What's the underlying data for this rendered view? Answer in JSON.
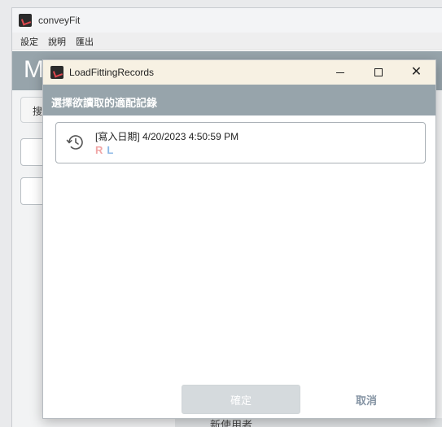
{
  "main_window": {
    "title": "conveyFit",
    "icon": "app-logo-icon",
    "menu": [
      "設定",
      "說明",
      "匯出"
    ],
    "header_letter": "M",
    "search_label": "搜",
    "bottom_text": "新使用者"
  },
  "dialog": {
    "title": "LoadFittingRecords",
    "icon": "app-logo-icon",
    "window_buttons": [
      "minimize-icon",
      "maximize-icon",
      "close-icon"
    ],
    "heading": "選擇欲讀取的適配記錄",
    "records": [
      {
        "date_text": "[寫入日期] 4/20/2023 4:50:59 PM",
        "right_label": "R",
        "left_label": "L",
        "icon": "history-icon"
      }
    ],
    "confirm_label": "確定",
    "cancel_label": "取消"
  },
  "colors": {
    "header_bg": "#97a4ab",
    "dialog_titlebar_bg": "#f7f1e3",
    "right_color": "#f0a6a6",
    "left_color": "#8cb8e6",
    "cancel_color": "#8493a3",
    "confirm_disabled_bg": "#d5dadd"
  }
}
